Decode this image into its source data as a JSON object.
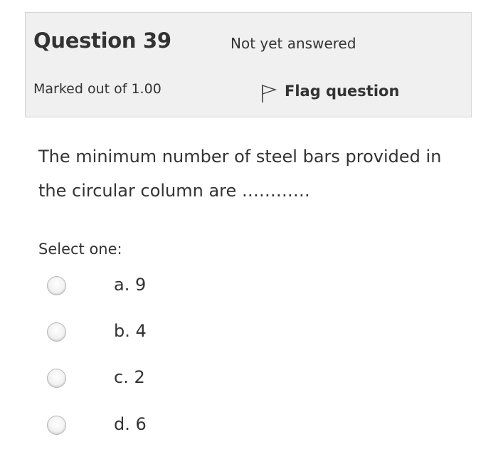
{
  "question": {
    "title": "Question 39",
    "state": "Not yet answered",
    "grade": "Marked out of 1.00",
    "flag_label": "Flag question",
    "text": "The minimum number of steel bars provided in the circular column are …………",
    "prompt": "Select one:"
  },
  "answers": [
    {
      "label": "a. 9",
      "selected": false
    },
    {
      "label": "b. 4",
      "selected": false
    },
    {
      "label": "c. 2",
      "selected": false
    },
    {
      "label": "d. 6",
      "selected": false
    }
  ],
  "icons": {
    "flag": "flag-icon",
    "radio": "radio-button"
  },
  "colors": {
    "info_background": "#f0f0f0",
    "info_border": "#d4d4d4",
    "text": "#333333"
  }
}
